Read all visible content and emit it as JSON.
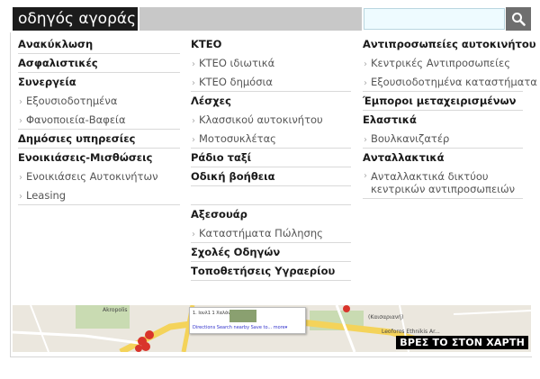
{
  "header": {
    "title": "οδηγός αγοράς",
    "search": {
      "value": "",
      "placeholder": ""
    },
    "search_button_icon": "magnifier-icon"
  },
  "columns": {
    "col1": {
      "c1": "Ανακύκλωση",
      "c2": "Ασφαλιστικές",
      "c3": "Συνεργεία",
      "c3_sub1": "Εξουσιοδοτημένα",
      "c3_sub2": "Φανοποιεία-Βαφεία",
      "c4": "Δημόσιες υπηρεσίες",
      "c5": "Ενοικιάσεις-Μισθώσεις",
      "c5_sub1": "Ενοικιάσεις Αυτοκινήτων",
      "c5_sub2": "Leasing"
    },
    "col2": {
      "c1": "ΚΤΕΟ",
      "c1_sub1": "ΚΤΕΟ ιδιωτικά",
      "c1_sub2": "ΚΤΕΟ δημόσια",
      "c2": "Λέσχες",
      "c2_sub1": "Κλασσικού αυτοκινήτου",
      "c2_sub2": "Μοτοσυκλέτας",
      "c3": "Ράδιο ταξί",
      "c4": "Οδική βοήθεια",
      "c5": "Αξεσουάρ",
      "c5_sub1": "Καταστήματα Πώλησης",
      "c6": "Σχολές Οδηγών",
      "c7": "Τοποθετήσεις Υγραερίου"
    },
    "col3": {
      "c1": "Αντιπροσωπείες αυτοκινήτου",
      "c1_sub1": "Κεντρικές Αντιπροσωπείες",
      "c1_sub2": "Εξουσιοδοτημένα καταστήματα",
      "c2": "Έμποροι μεταχειρισμένων",
      "c3": "Ελαστικά",
      "c3_sub1": "Βουλκανιζατέρ",
      "c4": "Ανταλλακτικά",
      "c4_sub1": "Ανταλλακτικά δικτύου κεντρικών αντιπροσωπειών"
    }
  },
  "map": {
    "cta": "ΒΡΕΣ ΤΟ ΣΤΟΝ ΧΑΡΤΗ",
    "labels": {
      "acropolis": "Akropolis",
      "kaisariani": "(Καισαριανή)",
      "lenforos": "Leoforos Ethnikis Ar..."
    },
    "popup": {
      "title": "1. Ιουλ1 1 Χαλάν",
      "links": "Directions  Search nearby  Save to...  more▾"
    },
    "colors": {
      "road": "#f4d35a",
      "park": "#c9dbb2",
      "marker": "#d9342b"
    }
  },
  "colors": {
    "header_bg": "#1c1c1c",
    "header_fill": "#c8c8c8",
    "search_bg": "#eefbff",
    "search_btn": "#6e6e6e"
  }
}
